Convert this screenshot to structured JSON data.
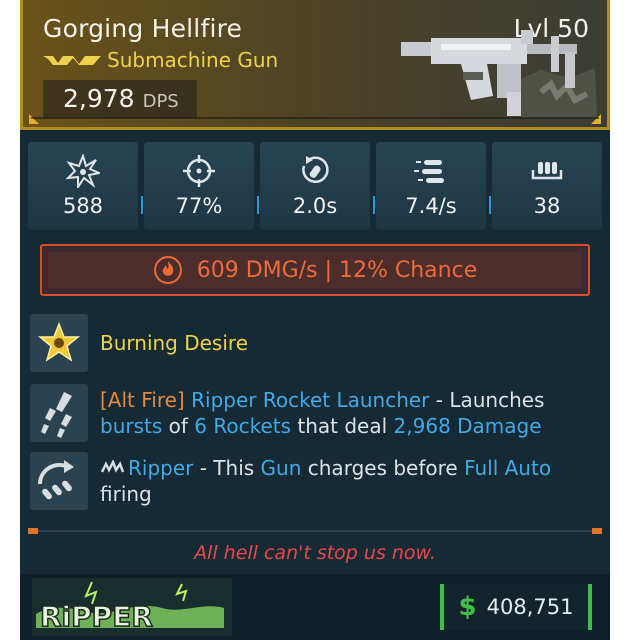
{
  "weapon": {
    "name": "Gorging Hellfire",
    "level": "Lvl 50",
    "type": "Submachine Gun",
    "dps_value": "2,978",
    "dps_unit": "DPS",
    "rarity_color": "#f0d24a"
  },
  "stats": [
    {
      "icon": "damage-burst-icon",
      "value": "588"
    },
    {
      "icon": "crosshair-icon",
      "value": "77%"
    },
    {
      "icon": "reload-icon",
      "value": "2.0s"
    },
    {
      "icon": "fire-rate-icon",
      "value": "7.4/s"
    },
    {
      "icon": "magazine-icon",
      "value": "38"
    }
  ],
  "elemental": {
    "icon": "fire-icon",
    "text": "609 DMG/s | 12% Chance",
    "color": "#ee6a3a"
  },
  "perks": {
    "legendary": {
      "icon": "legendary-star-icon",
      "name": "Burning Desire"
    },
    "alt_fire": {
      "icon": "rocket-icon",
      "tag": "[Alt Fire]",
      "name": "Ripper Rocket Launcher",
      "desc1": " - Launches",
      "word_bursts": "bursts",
      "word_of": " of ",
      "word_rockets": "6 Rockets",
      "word_deal": " that deal ",
      "word_damage": "2,968 Damage"
    },
    "manufacturer": {
      "icon": "spin-up-icon",
      "name": "Ripper",
      "desc1": " - This ",
      "word_gun": "Gun",
      "desc2": " charges before ",
      "word_full_auto": "Full Auto",
      "desc3": "firing"
    }
  },
  "flavor_text": "All hell can't stop us now.",
  "footer": {
    "manufacturer": "Ripper",
    "price_sign": "$",
    "price": "408,751"
  }
}
